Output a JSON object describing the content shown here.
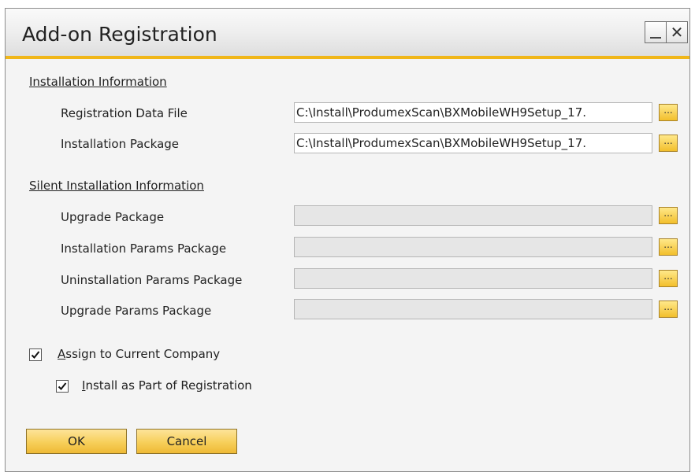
{
  "window": {
    "title": "Add-on Registration",
    "minimize_glyph": "_",
    "close_glyph": "✕"
  },
  "installation_info": {
    "header": "Installation Information",
    "fields": [
      {
        "label": "Registration Data File",
        "value": "C:\\Install\\ProdumexScan\\BXMobileWH9Setup_17.",
        "browse": "..."
      },
      {
        "label": "Installation Package",
        "value": "C:\\Install\\ProdumexScan\\BXMobileWH9Setup_17.",
        "browse": "..."
      }
    ]
  },
  "silent_info": {
    "header": "Silent Installation Information",
    "fields": [
      {
        "label": "Upgrade Package",
        "value": "",
        "browse": "..."
      },
      {
        "label": "Installation Params Package",
        "value": "",
        "browse": "..."
      },
      {
        "label": "Uninstallation Params Package",
        "value": "",
        "browse": "..."
      },
      {
        "label": "Upgrade Params Package",
        "value": "",
        "browse": "..."
      }
    ]
  },
  "options": {
    "assign_company": {
      "mnemonic": "A",
      "rest": "ssign to Current Company",
      "checked": true
    },
    "install_registration": {
      "mnemonic": "I",
      "rest": "nstall as Part of Registration",
      "checked": true
    }
  },
  "buttons": {
    "ok": "OK",
    "cancel": "Cancel"
  },
  "colors": {
    "accent": "#f0b619",
    "button_gold": "#f7cf5a"
  }
}
